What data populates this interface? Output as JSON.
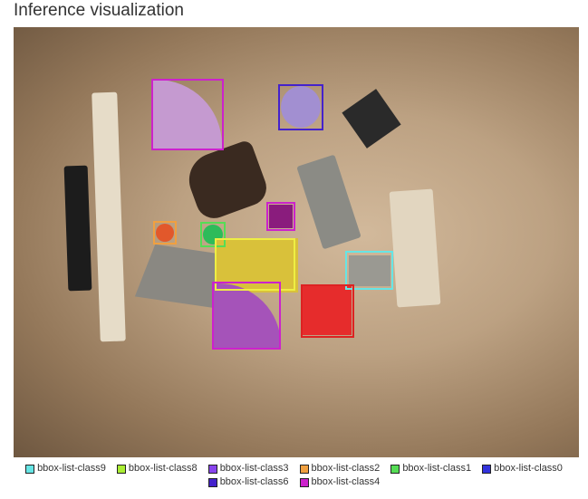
{
  "title": "Inference visualization",
  "legend": {
    "row1": [
      {
        "label": "bbox-list-class9",
        "color": "#66e5e5"
      },
      {
        "label": "bbox-list-class8",
        "color": "#aaee33"
      },
      {
        "label": "bbox-list-class3",
        "color": "#8844ee"
      },
      {
        "label": "bbox-list-class2",
        "color": "#f0a040"
      },
      {
        "label": "bbox-list-class1",
        "color": "#55dd55"
      },
      {
        "label": "bbox-list-class0",
        "color": "#3333dd"
      }
    ],
    "row2": [
      {
        "label": "bbox-list-class6",
        "color": "#4422cc"
      },
      {
        "label": "bbox-list-class4",
        "color": "#cc22cc"
      }
    ]
  }
}
